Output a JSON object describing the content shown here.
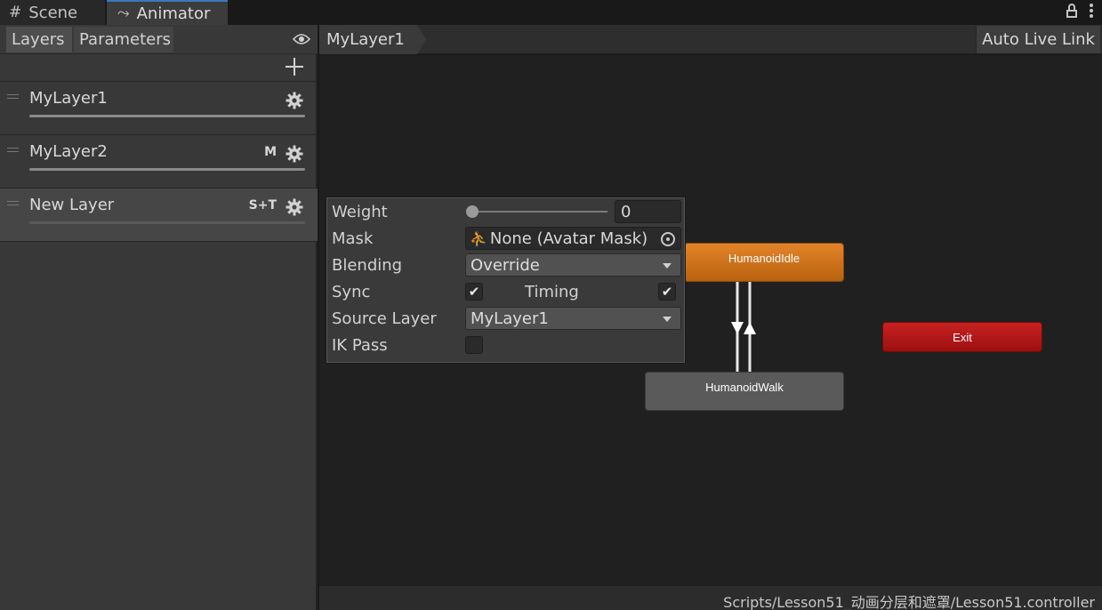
{
  "tabs": {
    "scene": {
      "label": "Scene",
      "icon": "grid-icon"
    },
    "animator": {
      "label": "Animator",
      "icon": "animator-icon"
    }
  },
  "left_panel": {
    "tabs": [
      "Layers",
      "Parameters"
    ],
    "active_tab": "Layers",
    "layers": [
      {
        "name": "MyLayer1",
        "flags": "",
        "weight": 1
      },
      {
        "name": "MyLayer2",
        "flags": "M",
        "weight": 1
      },
      {
        "name": "New Layer",
        "flags": "S+T",
        "weight": 0,
        "selected": true
      }
    ]
  },
  "graph": {
    "breadcrumb": "MyLayer1",
    "auto_live_link": "Auto Live Link",
    "nodes": {
      "idle": "HumanoidIdle",
      "walk": "HumanoidWalk",
      "exit": "Exit"
    },
    "status_path": "Scripts/Lesson51_动画分层和遮罩/Lesson51.controller"
  },
  "layer_settings": {
    "weight_label": "Weight",
    "weight_value": "0",
    "mask_label": "Mask",
    "mask_value": "None (Avatar Mask)",
    "blending_label": "Blending",
    "blending_value": "Override",
    "sync_label": "Sync",
    "sync_checked": true,
    "timing_label": "Timing",
    "timing_checked": true,
    "source_layer_label": "Source Layer",
    "source_layer_value": "MyLayer1",
    "ik_pass_label": "IK Pass",
    "ik_pass_checked": false
  },
  "colors": {
    "idle_node": "#d9761e",
    "exit_node": "#b81818",
    "walk_node": "#5a5a5a",
    "selected_tab_accent": "#3a79bb"
  }
}
